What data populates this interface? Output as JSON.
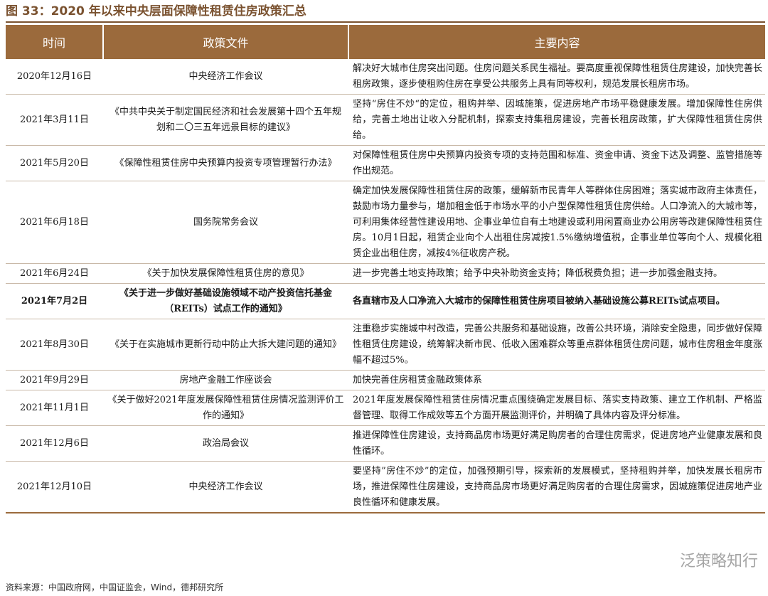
{
  "title": "图 33：2020 年以来中央层面保障性租赁住房政策汇总",
  "headers": {
    "time": "时间",
    "doc": "政策文件",
    "content": "主要内容"
  },
  "rows": [
    {
      "date": "2020年12月16日",
      "doc": "中央经济工作会议",
      "content": "解决好大城市住房突出问题。住房问题关系民生福祉。要高度重视保障性租赁住房建设，加快完善长租房政策，逐步使租购住房在享受公共服务上具有同等权利，规范发展长租房市场。"
    },
    {
      "date": "2021年3月11日",
      "doc": "《中共中央关于制定国民经济和社会发展第十四个五年规划和二〇三五年远景目标的建议》",
      "content": "坚持“房住不炒“的定位，租购并举、因城施策，促进房地产市场平稳健康发展。增加保障性住房供给，完善土地出让收入分配机制，探索支持集租房建设，完善长租房政策，扩大保障性租赁住房供给。"
    },
    {
      "date": "2021年5月20日",
      "doc": "《保障性租赁住房中央预算内投资专项管理暂行办法》",
      "content": "对保障性租赁住房中央预算内投资专项的支持范围和标准、资金申请、资金下达及调整、监管措施等作出规范。"
    },
    {
      "date": "2021年6月18日",
      "doc": "国务院常务会议",
      "content": "确定加快发展保障性租赁住房的政策，缓解新市民青年人等群体住房困难；落实城市政府主体责任，鼓励市场力量参与，增加租金低于市场水平的小户型保障性租赁住房供给。人口净流入的大城市等，可利用集体经营性建设用地、企事业单位自有土地建设或利用闲置商业办公用房等改建保障性租赁住房。10月1日起，租赁企业向个人出租住房减按1.5%缴纳增值税，企事业单位等向个人、规模化租赁企业出租住房，减按4%征收房产税。"
    },
    {
      "date": "2021年6月24日",
      "doc": "《关于加快发展保障性租赁住房的意见》",
      "content": "进一步完善土地支持政策；给予中央补助资金支持；降低税费负担；进一步加强金融支持。"
    },
    {
      "date": "2021年7月2日",
      "doc": "《关于进一步做好基础设施领域不动产投资信托基金（REITs）试点工作的通知》",
      "content": "各直辖市及人口净流入大城市的保障性租赁住房项目被纳入基础设施公募REITs试点项目。",
      "bold": true
    },
    {
      "date": "2021年8月30日",
      "doc": "《关于在实施城市更新行动中防止大拆大建问题的通知》",
      "content": "注重稳步实施城中村改造，完善公共服务和基础设施，改善公共环境，消除安全隐患，同步做好保障性租赁住房建设，统筹解决新市民、低收入困难群众等重点群体租赁住房问题，城市住房租金年度涨幅不超过5%。"
    },
    {
      "date": "2021年9月29日",
      "doc": "房地产金融工作座谈会",
      "content": "加快完善住房租赁金融政策体系"
    },
    {
      "date": "2021年11月1日",
      "doc": "《关于做好2021年度发展保障性租赁住房情况监测评价工作的通知》",
      "content": "2021年度发展保障性租赁住房情况重点围绕确定发展目标、落实支持政策、建立工作机制、严格监督管理、取得工作成效等五个方面开展监测评价，并明确了具体内容及评分标准。"
    },
    {
      "date": "2021年12月6日",
      "doc": "政治局会议",
      "content": "推进保障性住房建设，支持商品房市场更好满足购房者的合理住房需求，促进房地产业健康发展和良性循环。"
    },
    {
      "date": "2021年12月10日",
      "doc": "中央经济工作会议",
      "content": "要坚持”房住不炒”的定位，加强预期引导，探索新的发展模式，坚持租购并举，加快发展长租房市场，推进保障性住房建设，支持商品房市场更好满足购房者的合理住房需求，因城施策促进房地产业良性循环和健康发展。"
    }
  ],
  "source": "资料来源：中国政府网，中国证监会，Wind，德邦研究所",
  "watermark": "泛策略知行"
}
